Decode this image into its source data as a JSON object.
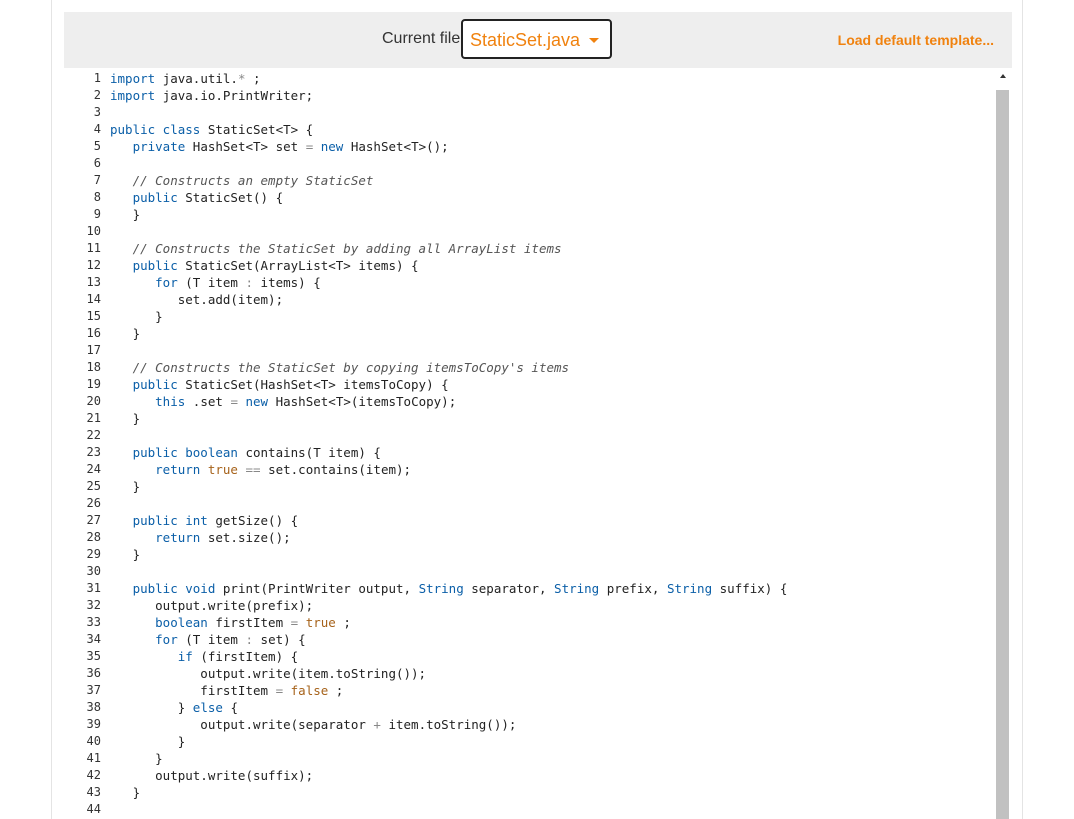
{
  "header": {
    "current_file_label": "Current file:",
    "file_name": "StaticSet.java",
    "load_template": "Load default template..."
  },
  "colors": {
    "accent": "#f0820f",
    "keyword": "#0b5fa8",
    "literal": "#a6621a"
  },
  "icons": {
    "dropdown": "chevron-down-icon",
    "scroll_up": "arrow-up-icon"
  },
  "code_lines": [
    {
      "n": "1",
      "t": [
        [
          "kw",
          "import"
        ],
        [
          "",
          "java.util."
        ],
        [
          "op",
          "*"
        ],
        [
          "",
          ";"
        ]
      ]
    },
    {
      "n": "2",
      "t": [
        [
          "kw",
          "import"
        ],
        [
          "",
          "java.io.PrintWriter;"
        ]
      ]
    },
    {
      "n": "3",
      "t": []
    },
    {
      "n": "4",
      "t": [
        [
          "kw",
          "public class"
        ],
        [
          "",
          "StaticSet<T> {"
        ]
      ]
    },
    {
      "n": "5",
      "t": [
        [
          "",
          "   "
        ],
        [
          "kw",
          "private"
        ],
        [
          "",
          "HashSet<T> set "
        ],
        [
          "op",
          "="
        ],
        [
          "kw",
          "new"
        ],
        [
          "",
          "HashSet<T>();"
        ]
      ]
    },
    {
      "n": "6",
      "t": []
    },
    {
      "n": "7",
      "t": [
        [
          "",
          "   "
        ],
        [
          "cm",
          "// Constructs an empty StaticSet"
        ]
      ]
    },
    {
      "n": "8",
      "t": [
        [
          "",
          "   "
        ],
        [
          "kw",
          "public"
        ],
        [
          "",
          "StaticSet() {"
        ]
      ]
    },
    {
      "n": "9",
      "t": [
        [
          "",
          "   }"
        ]
      ]
    },
    {
      "n": "10",
      "t": []
    },
    {
      "n": "11",
      "t": [
        [
          "",
          "   "
        ],
        [
          "cm",
          "// Constructs the StaticSet by adding all ArrayList items"
        ]
      ]
    },
    {
      "n": "12",
      "t": [
        [
          "",
          "   "
        ],
        [
          "kw",
          "public"
        ],
        [
          "",
          "StaticSet(ArrayList<T> items) {"
        ]
      ]
    },
    {
      "n": "13",
      "t": [
        [
          "",
          "      "
        ],
        [
          "kw",
          "for"
        ],
        [
          "",
          "(T item "
        ],
        [
          "op",
          ":"
        ],
        [
          "",
          "items) {"
        ]
      ]
    },
    {
      "n": "14",
      "t": [
        [
          "",
          "         set.add(item);"
        ]
      ]
    },
    {
      "n": "15",
      "t": [
        [
          "",
          "      }"
        ]
      ]
    },
    {
      "n": "16",
      "t": [
        [
          "",
          "   }"
        ]
      ]
    },
    {
      "n": "17",
      "t": []
    },
    {
      "n": "18",
      "t": [
        [
          "",
          "   "
        ],
        [
          "cm",
          "// Constructs the StaticSet by copying itemsToCopy's items"
        ]
      ]
    },
    {
      "n": "19",
      "t": [
        [
          "",
          "   "
        ],
        [
          "kw",
          "public"
        ],
        [
          "",
          "StaticSet(HashSet<T> itemsToCopy) {"
        ]
      ]
    },
    {
      "n": "20",
      "t": [
        [
          "",
          "      "
        ],
        [
          "kw",
          "this"
        ],
        [
          "",
          ".set "
        ],
        [
          "op",
          "="
        ],
        [
          "kw",
          "new"
        ],
        [
          "",
          "HashSet<T>(itemsToCopy);"
        ]
      ]
    },
    {
      "n": "21",
      "t": [
        [
          "",
          "   }"
        ]
      ]
    },
    {
      "n": "22",
      "t": []
    },
    {
      "n": "23",
      "t": [
        [
          "",
          "   "
        ],
        [
          "kw",
          "public boolean"
        ],
        [
          "",
          "contains(T item) {"
        ]
      ]
    },
    {
      "n": "24",
      "t": [
        [
          "",
          "      "
        ],
        [
          "kw",
          "return"
        ],
        [
          "lit",
          "true"
        ],
        [
          "op",
          "=="
        ],
        [
          "",
          "set.contains(item);"
        ]
      ]
    },
    {
      "n": "25",
      "t": [
        [
          "",
          "   }"
        ]
      ]
    },
    {
      "n": "26",
      "t": []
    },
    {
      "n": "27",
      "t": [
        [
          "",
          "   "
        ],
        [
          "kw",
          "public int"
        ],
        [
          "",
          "getSize() {"
        ]
      ]
    },
    {
      "n": "28",
      "t": [
        [
          "",
          "      "
        ],
        [
          "kw",
          "return"
        ],
        [
          "",
          "set.size();"
        ]
      ]
    },
    {
      "n": "29",
      "t": [
        [
          "",
          "   }"
        ]
      ]
    },
    {
      "n": "30",
      "t": []
    },
    {
      "n": "31",
      "t": [
        [
          "",
          "   "
        ],
        [
          "kw",
          "public void"
        ],
        [
          "",
          "print(PrintWriter output, "
        ],
        [
          "kw",
          "String"
        ],
        [
          "",
          "separator, "
        ],
        [
          "kw",
          "String"
        ],
        [
          "",
          "prefix, "
        ],
        [
          "kw",
          "String"
        ],
        [
          "",
          "suffix) {"
        ]
      ]
    },
    {
      "n": "32",
      "t": [
        [
          "",
          "      output.write(prefix);"
        ]
      ]
    },
    {
      "n": "33",
      "t": [
        [
          "",
          "      "
        ],
        [
          "kw",
          "boolean"
        ],
        [
          "",
          "firstItem "
        ],
        [
          "op",
          "="
        ],
        [
          "lit",
          "true"
        ],
        [
          "",
          ";"
        ]
      ]
    },
    {
      "n": "34",
      "t": [
        [
          "",
          "      "
        ],
        [
          "kw",
          "for"
        ],
        [
          "",
          "(T item "
        ],
        [
          "op",
          ":"
        ],
        [
          "",
          "set) {"
        ]
      ]
    },
    {
      "n": "35",
      "t": [
        [
          "",
          "         "
        ],
        [
          "kw",
          "if"
        ],
        [
          "",
          "(firstItem) {"
        ]
      ]
    },
    {
      "n": "36",
      "t": [
        [
          "",
          "            output.write(item.toString());"
        ]
      ]
    },
    {
      "n": "37",
      "t": [
        [
          "",
          "            firstItem "
        ],
        [
          "op",
          "="
        ],
        [
          "lit",
          "false"
        ],
        [
          "",
          ";"
        ]
      ]
    },
    {
      "n": "38",
      "t": [
        [
          "",
          "         } "
        ],
        [
          "kw",
          "else"
        ],
        [
          "",
          "{"
        ]
      ]
    },
    {
      "n": "39",
      "t": [
        [
          "",
          "            output.write(separator "
        ],
        [
          "op",
          "+"
        ],
        [
          "",
          "item.toString());"
        ]
      ]
    },
    {
      "n": "40",
      "t": [
        [
          "",
          "         }"
        ]
      ]
    },
    {
      "n": "41",
      "t": [
        [
          "",
          "      }"
        ]
      ]
    },
    {
      "n": "42",
      "t": [
        [
          "",
          "      output.write(suffix);"
        ]
      ]
    },
    {
      "n": "43",
      "t": [
        [
          "",
          "   }"
        ]
      ]
    },
    {
      "n": "44",
      "t": []
    }
  ]
}
